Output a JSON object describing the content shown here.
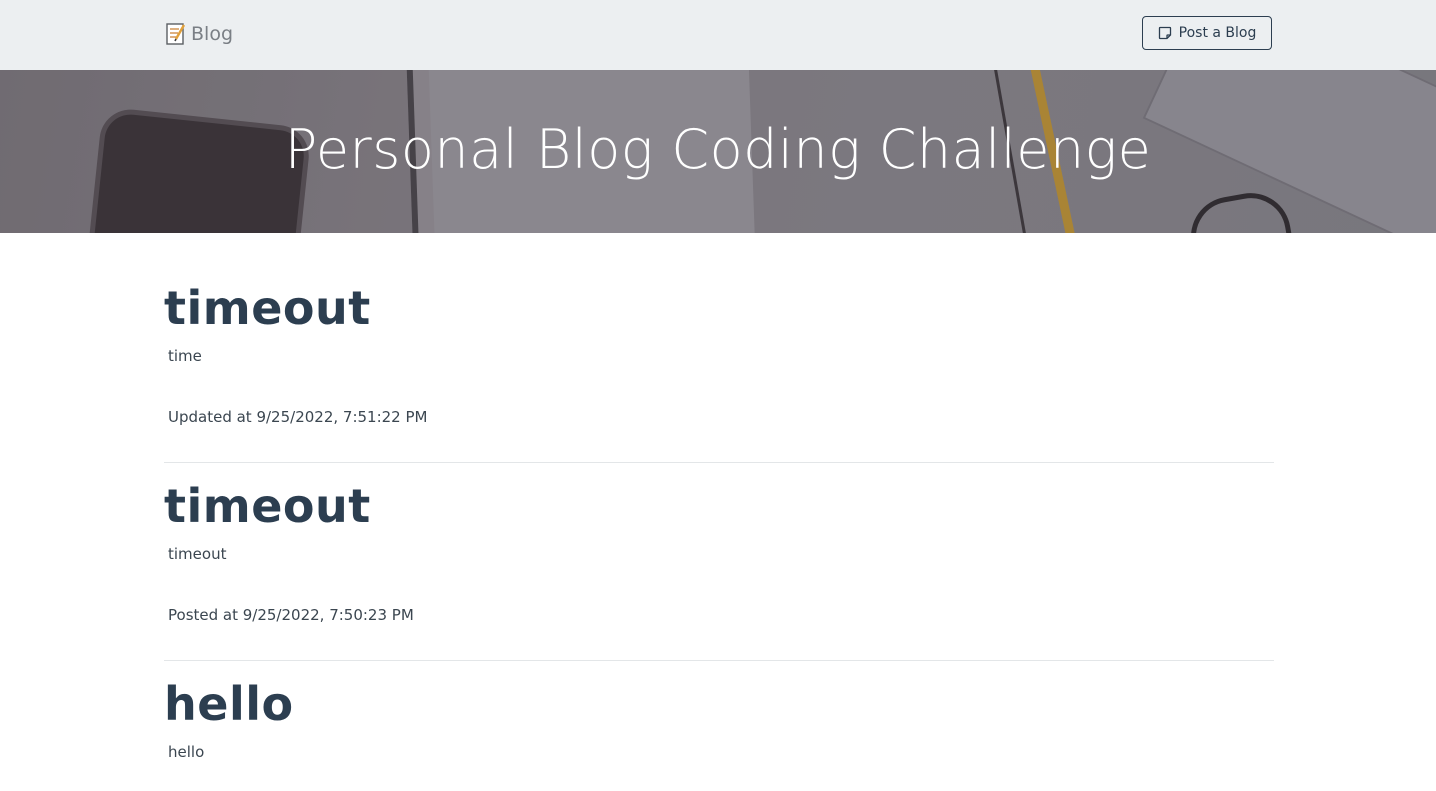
{
  "navbar": {
    "brand_label": "Blog",
    "brand_icon": "memo-icon",
    "post_button_label": "Post a Blog",
    "post_button_icon": "sticky-note-icon"
  },
  "hero": {
    "title": "Personal Blog Coding Challenge"
  },
  "posts": [
    {
      "title": "timeout",
      "body": "time",
      "meta": "Updated at 9/25/2022, 7:51:22 PM"
    },
    {
      "title": "timeout",
      "body": "timeout",
      "meta": "Posted at 9/25/2022, 7:50:23 PM"
    },
    {
      "title": "hello",
      "body": "hello",
      "meta": ""
    }
  ],
  "colors": {
    "navbar_bg": "#eceff1",
    "text_primary": "#2c3e50",
    "brand_text": "#7a7f85"
  }
}
